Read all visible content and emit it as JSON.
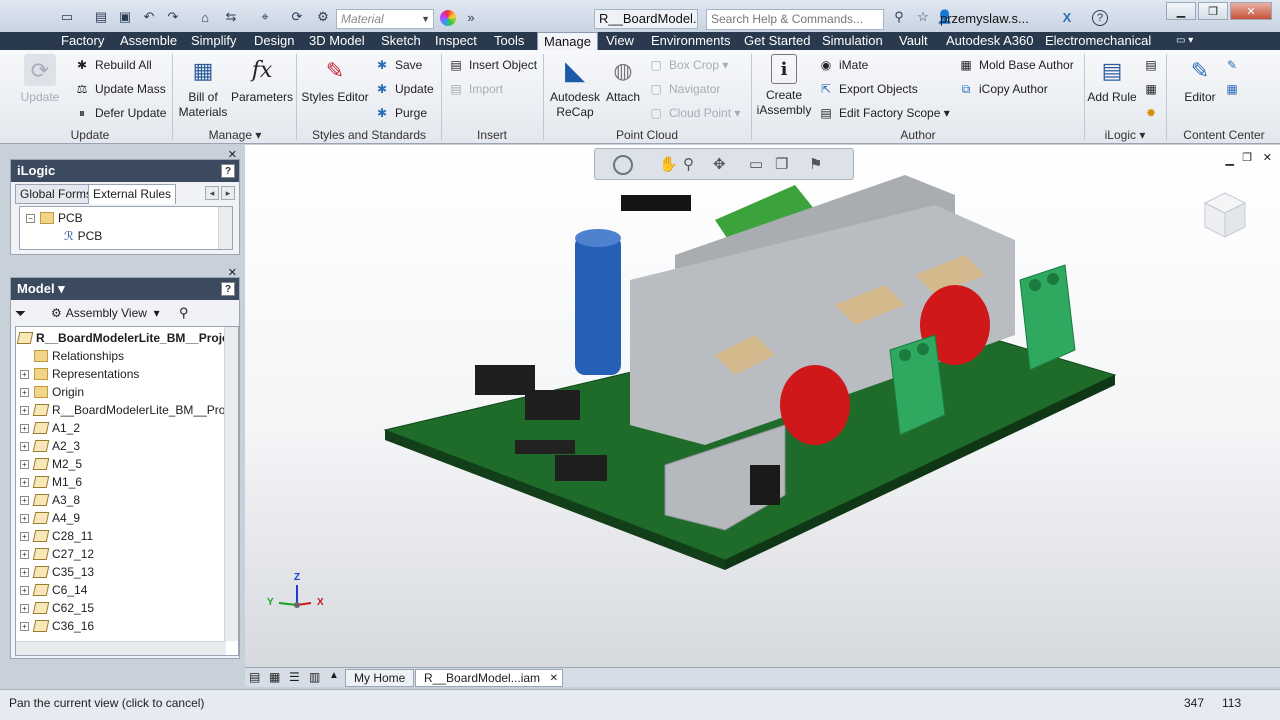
{
  "app": {
    "material_placeholder": "Material",
    "document_title": "R__BoardModel...",
    "search_placeholder": "Search Help & Commands...",
    "user": "przemyslaw.s..."
  },
  "tabs": [
    "Factory",
    "Assemble",
    "Simplify",
    "Design",
    "3D Model",
    "Sketch",
    "Inspect",
    "Tools",
    "Manage",
    "View",
    "Environments",
    "Get Started",
    "Simulation",
    "Vault",
    "Autodesk A360",
    "Electromechanical"
  ],
  "active_tab": "Manage",
  "ribbon": {
    "update": {
      "title": "Update",
      "update_label": "Update",
      "rebuild_all": "Rebuild All",
      "update_mass": "Update Mass",
      "defer_update": "Defer Update"
    },
    "manage": {
      "title": "Manage",
      "bom": "Bill of Materials",
      "parameters": "Parameters"
    },
    "styles": {
      "title": "Styles and Standards",
      "styles_editor": "Styles Editor",
      "save": "Save",
      "update": "Update",
      "purge": "Purge"
    },
    "insert": {
      "title": "Insert",
      "insert_object": "Insert Object",
      "import": "Import"
    },
    "point_cloud": {
      "title": "Point Cloud",
      "recap": "Autodesk ReCap",
      "attach": "Attach",
      "box_crop": "Box Crop",
      "navigator": "Navigator",
      "cloud_point": "Cloud Point"
    },
    "author": {
      "title": "Author",
      "create_iassembly": "Create iAssembly",
      "imate": "iMate",
      "export_objects": "Export Objects",
      "edit_factory_scope": "Edit Factory Scope",
      "mold_base_author": "Mold Base Author",
      "icopy_author": "iCopy Author"
    },
    "ilogic": {
      "title": "iLogic",
      "add_rule": "Add Rule"
    },
    "content_center": {
      "title": "Content Center",
      "editor": "Editor"
    }
  },
  "ilogic_panel": {
    "title": "iLogic",
    "tabs": [
      "Global Forms",
      "External Rules"
    ],
    "tree": [
      {
        "label": "PCB",
        "type": "folder"
      },
      {
        "label": "PCB",
        "type": "rule"
      }
    ]
  },
  "model_panel": {
    "title": "Model",
    "view": "Assembly View",
    "root": "R__BoardModelerLite_BM__Proje",
    "items": [
      {
        "label": "Relationships",
        "icon": "folder",
        "expand": false
      },
      {
        "label": "Representations",
        "icon": "folder",
        "expand": true
      },
      {
        "label": "Origin",
        "icon": "folder",
        "expand": true
      },
      {
        "label": "R__BoardModelerLite_BM__Project",
        "icon": "part",
        "expand": true
      },
      {
        "label": "A1_2",
        "icon": "part",
        "expand": true
      },
      {
        "label": "A2_3",
        "icon": "part",
        "expand": true
      },
      {
        "label": "M2_5",
        "icon": "part",
        "expand": true
      },
      {
        "label": "M1_6",
        "icon": "part",
        "expand": true
      },
      {
        "label": "A3_8",
        "icon": "part",
        "expand": true
      },
      {
        "label": "A4_9",
        "icon": "part",
        "expand": true
      },
      {
        "label": "C28_11",
        "icon": "part",
        "expand": true
      },
      {
        "label": "C27_12",
        "icon": "part",
        "expand": true
      },
      {
        "label": "C35_13",
        "icon": "part",
        "expand": true
      },
      {
        "label": "C6_14",
        "icon": "part",
        "expand": true
      },
      {
        "label": "C62_15",
        "icon": "part",
        "expand": true
      },
      {
        "label": "C36_16",
        "icon": "part",
        "expand": true
      }
    ]
  },
  "document_tabs": [
    "My Home",
    "R__BoardModel...iam"
  ],
  "status": {
    "message": "Pan the current view (click to cancel)",
    "x": "347",
    "y": "113"
  },
  "triad": {
    "x": "X",
    "y": "Y",
    "z": "Z"
  },
  "colors": {
    "ribbon_dark": "#2a3a4e",
    "panel_header": "#3b4a5e",
    "pcb_green": "#1e6b2a",
    "terminal_green": "#2fa860"
  }
}
